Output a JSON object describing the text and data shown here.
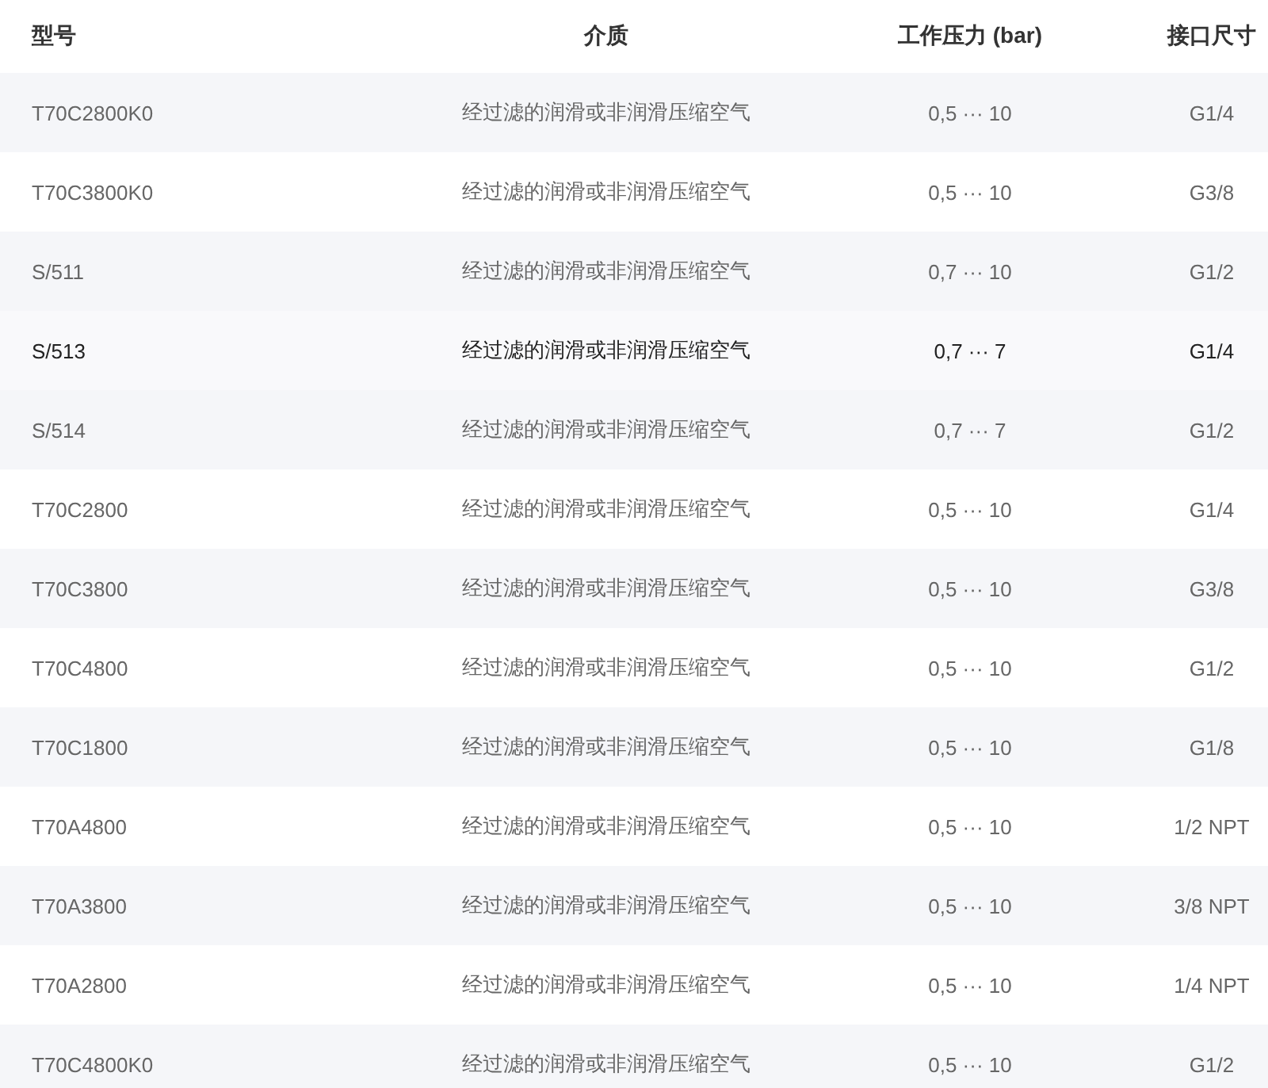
{
  "table": {
    "columns": [
      "型号",
      "介质",
      "工作压力 (bar)",
      "接口尺寸"
    ],
    "rows": [
      {
        "cells": [
          "T70C2800K0",
          "经过滤的润滑或非润滑压缩空气",
          "0,5 ··· 10",
          "G1/4"
        ],
        "highlighted": false
      },
      {
        "cells": [
          "T70C3800K0",
          "经过滤的润滑或非润滑压缩空气",
          "0,5 ··· 10",
          "G3/8"
        ],
        "highlighted": false
      },
      {
        "cells": [
          "S/511",
          "经过滤的润滑或非润滑压缩空气",
          "0,7 ··· 10",
          "G1/2"
        ],
        "highlighted": false
      },
      {
        "cells": [
          "S/513",
          "经过滤的润滑或非润滑压缩空气",
          "0,7 ··· 7",
          "G1/4"
        ],
        "highlighted": true
      },
      {
        "cells": [
          "S/514",
          "经过滤的润滑或非润滑压缩空气",
          "0,7 ··· 7",
          "G1/2"
        ],
        "highlighted": false
      },
      {
        "cells": [
          "T70C2800",
          "经过滤的润滑或非润滑压缩空气",
          "0,5 ··· 10",
          "G1/4"
        ],
        "highlighted": false
      },
      {
        "cells": [
          "T70C3800",
          "经过滤的润滑或非润滑压缩空气",
          "0,5 ··· 10",
          "G3/8"
        ],
        "highlighted": false
      },
      {
        "cells": [
          "T70C4800",
          "经过滤的润滑或非润滑压缩空气",
          "0,5 ··· 10",
          "G1/2"
        ],
        "highlighted": false
      },
      {
        "cells": [
          "T70C1800",
          "经过滤的润滑或非润滑压缩空气",
          "0,5 ··· 10",
          "G1/8"
        ],
        "highlighted": false
      },
      {
        "cells": [
          "T70A4800",
          "经过滤的润滑或非润滑压缩空气",
          "0,5 ··· 10",
          "1/2 NPT"
        ],
        "highlighted": false
      },
      {
        "cells": [
          "T70A3800",
          "经过滤的润滑或非润滑压缩空气",
          "0,5 ··· 10",
          "3/8 NPT"
        ],
        "highlighted": false
      },
      {
        "cells": [
          "T70A2800",
          "经过滤的润滑或非润滑压缩空气",
          "0,5 ··· 10",
          "1/4 NPT"
        ],
        "highlighted": false
      },
      {
        "cells": [
          "T70C4800K0",
          "经过滤的润滑或非润滑压缩空气",
          "0,5 ··· 10",
          "G1/2"
        ],
        "highlighted": false
      }
    ]
  }
}
